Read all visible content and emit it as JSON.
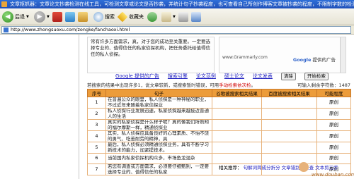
{
  "window": {
    "title": "文章抠抓器：文章论文抄袭检测在线工具，可检测文章或论文是否抄袭，并统计句子抄袭程度，也可查看自己所创作博客文章被抄袭的程度，不限制字数的检测文章"
  },
  "toolbar": {
    "back_label": "后退",
    "search_label": "搜索",
    "favorites_label": "收藏夹"
  },
  "address": {
    "url": "http://www.zhongsuoxu.com/zongke/fanchaoxi.html"
  },
  "ad_left": {
    "text": "真，对于您的成功至关重要。一定要选择专业的、值得信任的私家侦探机构，把任务委托给值得信任的私人侦探。",
    "prefix": "常有许多方面需求，"
  },
  "ad_right": {
    "domain": "www.Grammarly.com",
    "brand_prefix": "Google",
    "brand_suffix": "提供的广告"
  },
  "google_bar": {
    "ad_label": "Google 提供的广告",
    "links": [
      "搜索引擎",
      "论文范例",
      "硕士论文",
      "论文发表"
    ],
    "clear": "清除",
    "start": "开始检索"
  },
  "notice": {
    "text": "若搜索的结果中出现许多1，说文章较新，或搜索暂时错误，可用手动检索依次检。",
    "highlight": "手动检索依次检",
    "total": "可输入剩余字符数：1487"
  },
  "table": {
    "headers": [
      "序号",
      "句子",
      "谷歌被搜索相关结果",
      "百度被搜索相关结果",
      "可能程度"
    ],
    "rows": [
      {
        "num": "1",
        "sentence": "在普遍公众的眼里，私人侦探是一种神秘的职业，不过近年来随着私家侦探业",
        "google": "",
        "baidu": "",
        "level": "原创"
      },
      {
        "num": "2",
        "sentence": "私人侦探行业发展迅速，私家侦探越来越接近普通人的生活",
        "google": "",
        "baidu": "",
        "level": "原创"
      },
      {
        "num": "3",
        "sentence": "真实的私家侦探是什么样子呢？真的像我们所熟知的福尔摩斯一样，精通侦探业",
        "google": "",
        "baidu": "",
        "level": "原创"
      },
      {
        "num": "4",
        "sentence": "其实，私人侦探应具备良好的心理素质、不怕不饶的勇气、吃苦耐劳的精神，具",
        "google": "",
        "baidu": "",
        "level": "原创"
      },
      {
        "num": "5",
        "sentence": "最后，私人侦探必须精通侦探业务，具有不断学习新技术的能力，加紧提技术。",
        "google": "",
        "baidu": "",
        "level": "原创"
      },
      {
        "num": "6",
        "sentence": "当前国内私家侦探机构众多，市场鱼龙混杂",
        "google": "",
        "baidu": "",
        "level": "原创"
      },
      {
        "num": "7",
        "sentence": "若您有调查或方面需求，必须要仔细甄别，一定要选择专业的、值得信任的私家",
        "google": "",
        "baidu": "",
        "level": "原创"
      }
    ]
  },
  "related": {
    "label": "相关推荐：",
    "links": [
      "句解词简成分折分",
      "文章错别字检查",
      "文本剪刀手"
    ]
  },
  "watermark": {
    "url": "www.douban.com"
  }
}
